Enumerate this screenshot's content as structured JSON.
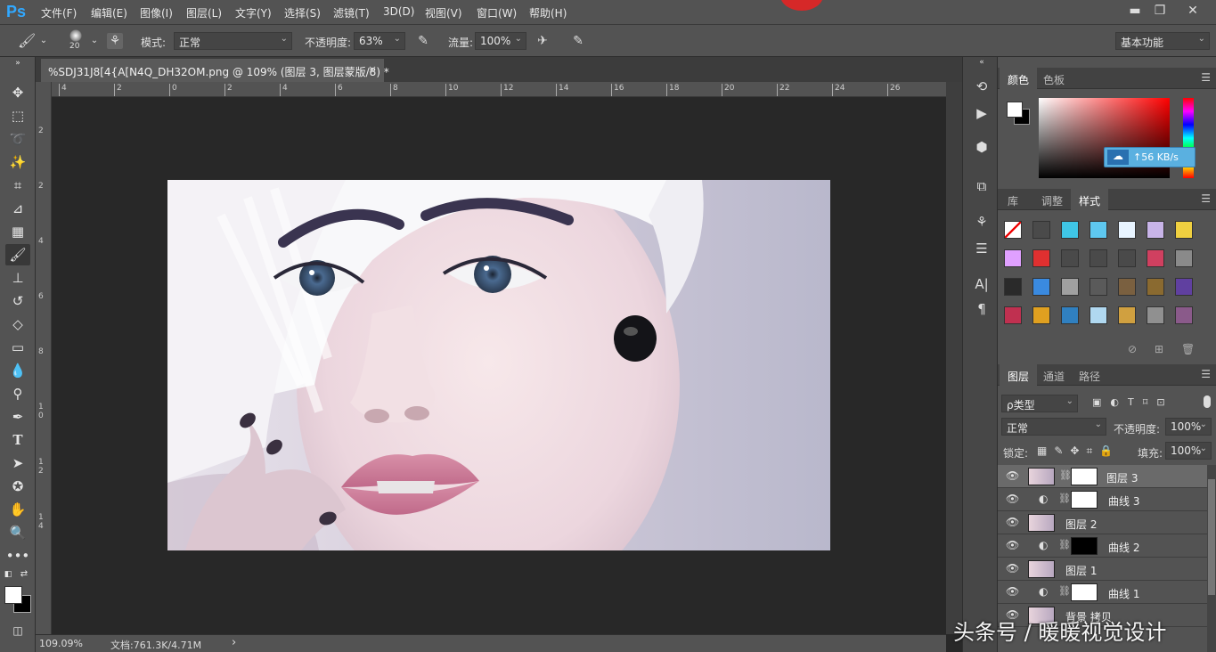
{
  "app": {
    "logo": "Ps"
  },
  "menu": [
    "文件(F)",
    "编辑(E)",
    "图像(I)",
    "图层(L)",
    "文字(Y)",
    "选择(S)",
    "滤镜(T)",
    "3D(D)",
    "视图(V)",
    "窗口(W)",
    "帮助(H)"
  ],
  "window_controls": {
    "minimize": "▬",
    "restore": "❐",
    "close": "✕"
  },
  "options": {
    "brush_size": "20",
    "mode_label": "模式:",
    "mode_value": "正常",
    "opacity_label": "不透明度:",
    "opacity_value": "63%",
    "flow_label": "流量:",
    "flow_value": "100%",
    "workspace": "基本功能"
  },
  "document": {
    "tab_title": "%SDJ31J8[4{A[N4Q_DH32OM.png @ 109% (图层 3, 图层蒙版/8) *",
    "close": "×"
  },
  "hruler_ticks": [
    "4",
    "2",
    "0",
    "2",
    "4",
    "6",
    "8",
    "10",
    "12",
    "14",
    "16",
    "18",
    "20",
    "22",
    "24",
    "26"
  ],
  "vruler_ticks": [
    "2",
    "2",
    "4",
    "6",
    "8",
    "1\n0",
    "1\n2",
    "1\n4"
  ],
  "status": {
    "zoom": "109.09%",
    "doc_label": "文档:761.3K/4.71M",
    "arrow": "›"
  },
  "color_panel": {
    "tabs": [
      "颜色",
      "色板"
    ],
    "speed_badge": "↑56 KB/s"
  },
  "styles_panel": {
    "tabs": [
      "库",
      "调整",
      "样式"
    ],
    "swatches": [
      "#ffffff",
      "#4a4a4a",
      "#3fc6e6",
      "#5ec8f0",
      "#e8f4ff",
      "#c8b4e8",
      "#f0d040",
      "#e0a0ff",
      "#e03030",
      "#4a4a4a",
      "#4a4a4a",
      "#4a4a4a",
      "#d04060",
      "#8a8a8a",
      "#2a2a2a",
      "#3a8ae0",
      "#a0a0a0",
      "#5a5a5a",
      "#7a6040",
      "#8a6a30",
      "#6040a0",
      "#c03050",
      "#e0a020",
      "#3080c0",
      "#b0d8f0",
      "#d0a040",
      "#909090",
      "#8a5a8a"
    ]
  },
  "layers_panel": {
    "tabs": [
      "图层",
      "通道",
      "路径"
    ],
    "filter_label": "ρ类型",
    "blend_mode": "正常",
    "opacity_label": "不透明度:",
    "opacity_value": "100%",
    "lock_label": "锁定:",
    "fill_label": "填充:",
    "fill_value": "100%",
    "layers": [
      {
        "name": "图层 3",
        "type": "image",
        "selected": true,
        "mask": "white-face"
      },
      {
        "name": "曲线 3",
        "type": "adjustment",
        "selected": false,
        "mask": "white"
      },
      {
        "name": "图层 2",
        "type": "image",
        "selected": false,
        "mask": ""
      },
      {
        "name": "曲线 2",
        "type": "adjustment",
        "selected": false,
        "mask": "black"
      },
      {
        "name": "图层 1",
        "type": "image",
        "selected": false,
        "mask": ""
      },
      {
        "name": "曲线 1",
        "type": "adjustment",
        "selected": false,
        "mask": "white"
      },
      {
        "name": "背景 拷贝",
        "type": "image",
        "selected": false,
        "mask": ""
      }
    ]
  },
  "watermark": "头条号 / 暖暖视觉设计"
}
